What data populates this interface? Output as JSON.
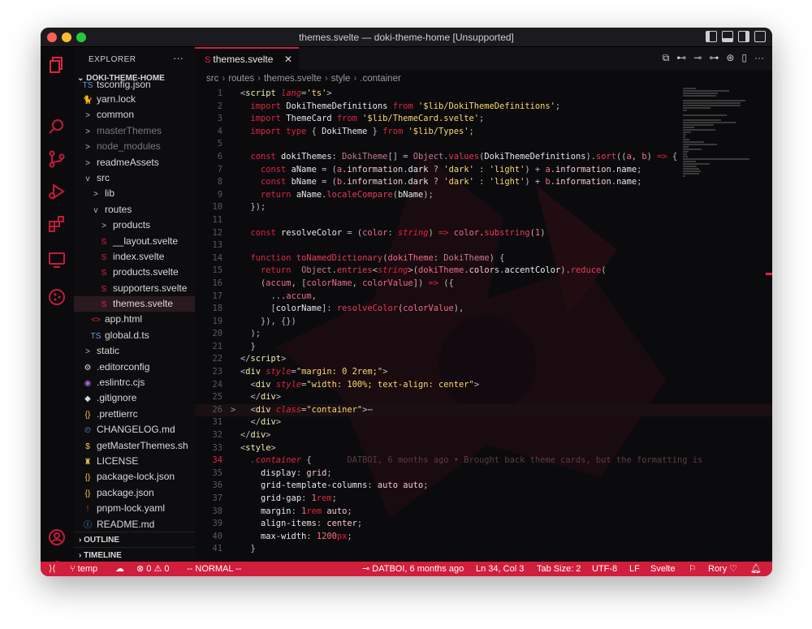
{
  "window": {
    "title": "themes.svelte — doki-theme-home [Unsupported]",
    "traffic": [
      "#ff5f57",
      "#febc2e",
      "#28c840"
    ]
  },
  "colors": {
    "accent": "#d11e3c",
    "bg": "#0b0b0e",
    "sidebar": "#0d0d10"
  },
  "activity_icons": [
    "explorer-icon",
    "search-icon",
    "source-control-icon",
    "run-debug-icon",
    "extensions-icon",
    "remote-explorer-icon",
    "github-icon",
    "account-icon",
    "settings-icon"
  ],
  "sidebar": {
    "header": "EXPLORER",
    "more": "···",
    "root": "DOKI-THEME-HOME",
    "items": [
      {
        "label": "tsconfig.json",
        "icon": "TS",
        "depth": 1,
        "dim": false
      },
      {
        "label": "yarn.lock",
        "icon": "🐈",
        "depth": 1,
        "dim": false
      },
      {
        "label": "common",
        "icon": ">",
        "depth": 1,
        "dim": false
      },
      {
        "label": "masterThemes",
        "icon": ">",
        "depth": 1,
        "dim": true
      },
      {
        "label": "node_modules",
        "icon": ">",
        "depth": 1,
        "dim": true
      },
      {
        "label": "readmeAssets",
        "icon": ">",
        "depth": 1,
        "dim": false
      },
      {
        "label": "src",
        "icon": "v",
        "depth": 1,
        "dim": false
      },
      {
        "label": "lib",
        "icon": ">",
        "depth": 2,
        "dim": false
      },
      {
        "label": "routes",
        "icon": "v",
        "depth": 2,
        "dim": false
      },
      {
        "label": "products",
        "icon": ">",
        "depth": 3,
        "dim": false
      },
      {
        "label": "__layout.svelte",
        "icon": "S",
        "depth": 3,
        "dim": false
      },
      {
        "label": "index.svelte",
        "icon": "S",
        "depth": 3,
        "dim": false
      },
      {
        "label": "products.svelte",
        "icon": "S",
        "depth": 3,
        "dim": false
      },
      {
        "label": "supporters.svelte",
        "icon": "S",
        "depth": 3,
        "dim": false
      },
      {
        "label": "themes.svelte",
        "icon": "S",
        "depth": 3,
        "dim": false,
        "selected": true
      },
      {
        "label": "app.html",
        "icon": "<>",
        "depth": 2,
        "dim": false
      },
      {
        "label": "global.d.ts",
        "icon": "TS",
        "depth": 2,
        "dim": false
      },
      {
        "label": "static",
        "icon": ">",
        "depth": 1,
        "dim": false
      },
      {
        "label": ".editorconfig",
        "icon": "⚙",
        "depth": 1,
        "dim": false
      },
      {
        "label": ".eslintrc.cjs",
        "icon": "◉",
        "depth": 1,
        "dim": false
      },
      {
        "label": ".gitignore",
        "icon": "◆",
        "depth": 1,
        "dim": false
      },
      {
        "label": ".prettierrc",
        "icon": "{}",
        "depth": 1,
        "dim": false
      },
      {
        "label": "CHANGELOG.md",
        "icon": "⏲",
        "depth": 1,
        "dim": false
      },
      {
        "label": "getMasterThemes.sh",
        "icon": "$",
        "depth": 1,
        "dim": false
      },
      {
        "label": "LICENSE",
        "icon": "♜",
        "depth": 1,
        "dim": false
      },
      {
        "label": "package-lock.json",
        "icon": "{}",
        "depth": 1,
        "dim": false
      },
      {
        "label": "package.json",
        "icon": "{}",
        "depth": 1,
        "dim": false
      },
      {
        "label": "pnpm-lock.yaml",
        "icon": "!",
        "depth": 1,
        "dim": false
      },
      {
        "label": "README.md",
        "icon": "ⓘ",
        "depth": 1,
        "dim": false
      }
    ],
    "outline": "OUTLINE",
    "timeline": "TIMELINE"
  },
  "tab": {
    "label": "themes.svelte",
    "close": "✕"
  },
  "editor_actions": [
    "⧉",
    "⊷",
    "⊸",
    "⊶",
    "⊛",
    "▯",
    "···"
  ],
  "breadcrumb": [
    "src",
    "routes",
    "themes.svelte",
    "style",
    ".container"
  ],
  "code": [
    {
      "n": "1",
      "t": [
        [
          "t-p",
          "<"
        ],
        [
          "t-tag",
          "script "
        ],
        [
          "t-attr",
          "lang"
        ],
        [
          "t-p",
          "="
        ],
        [
          "t-str",
          "'ts'"
        ],
        [
          "t-p",
          ">"
        ]
      ]
    },
    {
      "n": "2",
      "t": [
        [
          "t-kw",
          "  import "
        ],
        [
          "t-id",
          "DokiThemeDefinitions "
        ],
        [
          "t-kw",
          "from "
        ],
        [
          "t-str",
          "'$lib/DokiThemeDefinitions'"
        ],
        [
          "t-p",
          ";"
        ]
      ]
    },
    {
      "n": "3",
      "t": [
        [
          "t-kw",
          "  import "
        ],
        [
          "t-id",
          "ThemeCard "
        ],
        [
          "t-kw",
          "from "
        ],
        [
          "t-str",
          "'$lib/ThemeCard.svelte'"
        ],
        [
          "t-p",
          ";"
        ]
      ]
    },
    {
      "n": "4",
      "t": [
        [
          "t-kw",
          "  import type "
        ],
        [
          "t-p",
          "{ "
        ],
        [
          "t-id",
          "DokiTheme "
        ],
        [
          "t-p",
          "} "
        ],
        [
          "t-kw",
          "from "
        ],
        [
          "t-str",
          "'$lib/Types'"
        ],
        [
          "t-p",
          ";"
        ]
      ]
    },
    {
      "n": "5",
      "t": []
    },
    {
      "n": "6",
      "t": [
        [
          "t-kw",
          "  const "
        ],
        [
          "t-id",
          "dokiThemes"
        ],
        [
          "t-p",
          ": "
        ],
        [
          "t-ty",
          "DokiTheme"
        ],
        [
          "t-p",
          "[] = "
        ],
        [
          "t-ty",
          "Object"
        ],
        [
          "t-p",
          "."
        ],
        [
          "t-fn",
          "values"
        ],
        [
          "t-p",
          "("
        ],
        [
          "t-id",
          "DokiThemeDefinitions"
        ],
        [
          "t-p",
          ")."
        ],
        [
          "t-fn",
          "sort"
        ],
        [
          "t-p",
          "(("
        ],
        [
          "t-var",
          "a"
        ],
        [
          "t-p",
          ", "
        ],
        [
          "t-var",
          "b"
        ],
        [
          "t-p",
          ") "
        ],
        [
          "t-kw",
          "=> "
        ],
        [
          "t-p",
          "{"
        ]
      ]
    },
    {
      "n": "7",
      "t": [
        [
          "t-kw",
          "    const "
        ],
        [
          "t-id",
          "aName "
        ],
        [
          "t-p",
          "= ("
        ],
        [
          "t-var",
          "a"
        ],
        [
          "t-p",
          "."
        ],
        [
          "t-prop",
          "information"
        ],
        [
          "t-p",
          "."
        ],
        [
          "t-id",
          "dark "
        ],
        [
          "t-p",
          "? "
        ],
        [
          "t-str",
          "'dark' "
        ],
        [
          "t-p",
          ": "
        ],
        [
          "t-str",
          "'light'"
        ],
        [
          "t-p",
          ") + "
        ],
        [
          "t-var",
          "a"
        ],
        [
          "t-p",
          "."
        ],
        [
          "t-prop",
          "information"
        ],
        [
          "t-p",
          "."
        ],
        [
          "t-id",
          "name"
        ],
        [
          "t-p",
          ";"
        ]
      ]
    },
    {
      "n": "8",
      "t": [
        [
          "t-kw",
          "    const "
        ],
        [
          "t-id",
          "bName "
        ],
        [
          "t-p",
          "= ("
        ],
        [
          "t-var",
          "b"
        ],
        [
          "t-p",
          "."
        ],
        [
          "t-prop",
          "information"
        ],
        [
          "t-p",
          "."
        ],
        [
          "t-id",
          "dark "
        ],
        [
          "t-p",
          "? "
        ],
        [
          "t-str",
          "'dark' "
        ],
        [
          "t-p",
          ": "
        ],
        [
          "t-str",
          "'light'"
        ],
        [
          "t-p",
          ") + "
        ],
        [
          "t-var",
          "b"
        ],
        [
          "t-p",
          "."
        ],
        [
          "t-prop",
          "information"
        ],
        [
          "t-p",
          "."
        ],
        [
          "t-id",
          "name"
        ],
        [
          "t-p",
          ";"
        ]
      ]
    },
    {
      "n": "9",
      "t": [
        [
          "t-kw",
          "    return "
        ],
        [
          "t-id",
          "aName"
        ],
        [
          "t-p",
          "."
        ],
        [
          "t-fn",
          "localeCompare"
        ],
        [
          "t-p",
          "("
        ],
        [
          "t-id",
          "bName"
        ],
        [
          "t-p",
          ");"
        ]
      ]
    },
    {
      "n": "10",
      "t": [
        [
          "t-p",
          "  });"
        ]
      ]
    },
    {
      "n": "11",
      "t": []
    },
    {
      "n": "12",
      "t": [
        [
          "t-kw",
          "  const "
        ],
        [
          "t-id",
          "resolveColor "
        ],
        [
          "t-p",
          "= ("
        ],
        [
          "t-var",
          "color"
        ],
        [
          "t-p",
          ": "
        ],
        [
          "t-attr",
          "string"
        ],
        [
          "t-p",
          ") "
        ],
        [
          "t-kw",
          "=> "
        ],
        [
          "t-var",
          "color"
        ],
        [
          "t-p",
          "."
        ],
        [
          "t-fn",
          "substring"
        ],
        [
          "t-p",
          "("
        ],
        [
          "t-num",
          "1"
        ],
        [
          "t-p",
          ")"
        ]
      ]
    },
    {
      "n": "13",
      "t": []
    },
    {
      "n": "14",
      "t": [
        [
          "t-kw",
          "  function "
        ],
        [
          "t-fn",
          "toNamedDictionary"
        ],
        [
          "t-p",
          "("
        ],
        [
          "t-var",
          "dokiTheme"
        ],
        [
          "t-p",
          ": "
        ],
        [
          "t-ty",
          "DokiTheme"
        ],
        [
          "t-p",
          ") {"
        ]
      ]
    },
    {
      "n": "15",
      "t": [
        [
          "t-kw",
          "    return  "
        ],
        [
          "t-ty",
          "Object"
        ],
        [
          "t-p",
          "."
        ],
        [
          "t-fn",
          "entries"
        ],
        [
          "t-p",
          "<"
        ],
        [
          "t-attr",
          "string"
        ],
        [
          "t-p",
          ">("
        ],
        [
          "t-var",
          "dokiTheme"
        ],
        [
          "t-p",
          "."
        ],
        [
          "t-prop",
          "colors"
        ],
        [
          "t-p",
          "."
        ],
        [
          "t-id",
          "accentColor"
        ],
        [
          "t-p",
          ")."
        ],
        [
          "t-fn",
          "reduce"
        ],
        [
          "t-p",
          "("
        ]
      ]
    },
    {
      "n": "16",
      "t": [
        [
          "t-p",
          "    ("
        ],
        [
          "t-var",
          "accum"
        ],
        [
          "t-p",
          ", ["
        ],
        [
          "t-var",
          "colorName"
        ],
        [
          "t-p",
          ", "
        ],
        [
          "t-var",
          "colorValue"
        ],
        [
          "t-p",
          "]) "
        ],
        [
          "t-kw",
          "=> "
        ],
        [
          "t-p",
          "({"
        ]
      ]
    },
    {
      "n": "17",
      "t": [
        [
          "t-p",
          "      ..."
        ],
        [
          "t-var",
          "accum"
        ],
        [
          "t-p",
          ","
        ]
      ]
    },
    {
      "n": "18",
      "t": [
        [
          "t-p",
          "      ["
        ],
        [
          "t-id",
          "colorName"
        ],
        [
          "t-p",
          "]: "
        ],
        [
          "t-fn",
          "resolveColor"
        ],
        [
          "t-p",
          "("
        ],
        [
          "t-var",
          "colorValue"
        ],
        [
          "t-p",
          "),"
        ]
      ]
    },
    {
      "n": "19",
      "t": [
        [
          "t-p",
          "    }), {})"
        ]
      ]
    },
    {
      "n": "20",
      "t": [
        [
          "t-p",
          "  );"
        ]
      ]
    },
    {
      "n": "21",
      "t": [
        [
          "t-p",
          "  }"
        ]
      ]
    },
    {
      "n": "22",
      "t": [
        [
          "t-p",
          "</"
        ],
        [
          "t-tag",
          "script"
        ],
        [
          "t-p",
          ">"
        ]
      ]
    },
    {
      "n": "23",
      "t": [
        [
          "t-p",
          "<"
        ],
        [
          "t-tag",
          "div "
        ],
        [
          "t-attr",
          "style"
        ],
        [
          "t-p",
          "="
        ],
        [
          "t-str",
          "\"margin: 0 2rem;\""
        ],
        [
          "t-p",
          ">"
        ]
      ]
    },
    {
      "n": "24",
      "t": [
        [
          "t-p",
          "  <"
        ],
        [
          "t-tag",
          "div "
        ],
        [
          "t-attr",
          "style"
        ],
        [
          "t-p",
          "="
        ],
        [
          "t-str",
          "\"width: 100%; text-align: center\""
        ],
        [
          "t-p",
          ">"
        ]
      ]
    },
    {
      "n": "25",
      "t": [
        [
          "t-p",
          "  </"
        ],
        [
          "t-tag",
          "div"
        ],
        [
          "t-p",
          ">"
        ]
      ]
    },
    {
      "n": "26",
      "fold": ">",
      "hl": true,
      "t": [
        [
          "t-p",
          "  <"
        ],
        [
          "t-tag",
          "div "
        ],
        [
          "t-attr",
          "class"
        ],
        [
          "t-p",
          "="
        ],
        [
          "t-str",
          "\"container\""
        ],
        [
          "t-p",
          ">⋯"
        ]
      ]
    },
    {
      "n": "31",
      "t": [
        [
          "t-p",
          "  </"
        ],
        [
          "t-tag",
          "div"
        ],
        [
          "t-p",
          ">"
        ]
      ]
    },
    {
      "n": "32",
      "t": [
        [
          "t-p",
          "</"
        ],
        [
          "t-tag",
          "div"
        ],
        [
          "t-p",
          ">"
        ]
      ]
    },
    {
      "n": "33",
      "t": [
        [
          "t-p",
          "<"
        ],
        [
          "t-tag",
          "style"
        ],
        [
          "t-p",
          ">"
        ]
      ]
    },
    {
      "n": "34",
      "cur": true,
      "t": [
        [
          "t-attr",
          "  .container "
        ],
        [
          "t-p",
          "{"
        ],
        [
          "blame",
          "       DATBOI, 6 months ago • Brought back theme cards, but the formatting is"
        ]
      ]
    },
    {
      "n": "35",
      "t": [
        [
          "t-id",
          "    display"
        ],
        [
          "t-p",
          ": "
        ],
        [
          "t-prop",
          "grid"
        ],
        [
          "t-p",
          ";"
        ]
      ]
    },
    {
      "n": "36",
      "t": [
        [
          "t-id",
          "    grid-template-columns"
        ],
        [
          "t-p",
          ": "
        ],
        [
          "t-prop",
          "auto auto"
        ],
        [
          "t-p",
          ";"
        ]
      ]
    },
    {
      "n": "37",
      "t": [
        [
          "t-id",
          "    grid-gap"
        ],
        [
          "t-p",
          ": "
        ],
        [
          "t-num",
          "1"
        ],
        [
          "t-kw",
          "rem"
        ],
        [
          "t-p",
          ";"
        ]
      ]
    },
    {
      "n": "38",
      "t": [
        [
          "t-id",
          "    margin"
        ],
        [
          "t-p",
          ": "
        ],
        [
          "t-num",
          "1"
        ],
        [
          "t-kw",
          "rem "
        ],
        [
          "t-prop",
          "auto"
        ],
        [
          "t-p",
          ";"
        ]
      ]
    },
    {
      "n": "39",
      "t": [
        [
          "t-id",
          "    align-items"
        ],
        [
          "t-p",
          ": "
        ],
        [
          "t-prop",
          "center"
        ],
        [
          "t-p",
          ";"
        ]
      ]
    },
    {
      "n": "40",
      "t": [
        [
          "t-id",
          "    max-width"
        ],
        [
          "t-p",
          ": "
        ],
        [
          "t-num",
          "1200"
        ],
        [
          "t-kw",
          "px"
        ],
        [
          "t-p",
          ";"
        ]
      ]
    },
    {
      "n": "41",
      "t": [
        [
          "t-p",
          "  }"
        ]
      ]
    }
  ],
  "status": {
    "remote": "⟩⟨",
    "branch": "temp",
    "sync": "☁",
    "problems": "⊗ 0 ⚠ 0",
    "mode": "-- NORMAL --",
    "blame": "DATBOI, 6 months ago",
    "position": "Ln 34, Col 3",
    "tab_size": "Tab Size: 2",
    "encoding": "UTF-8",
    "eol": "LF",
    "language": "Svelte",
    "user": "Rory ♡"
  }
}
